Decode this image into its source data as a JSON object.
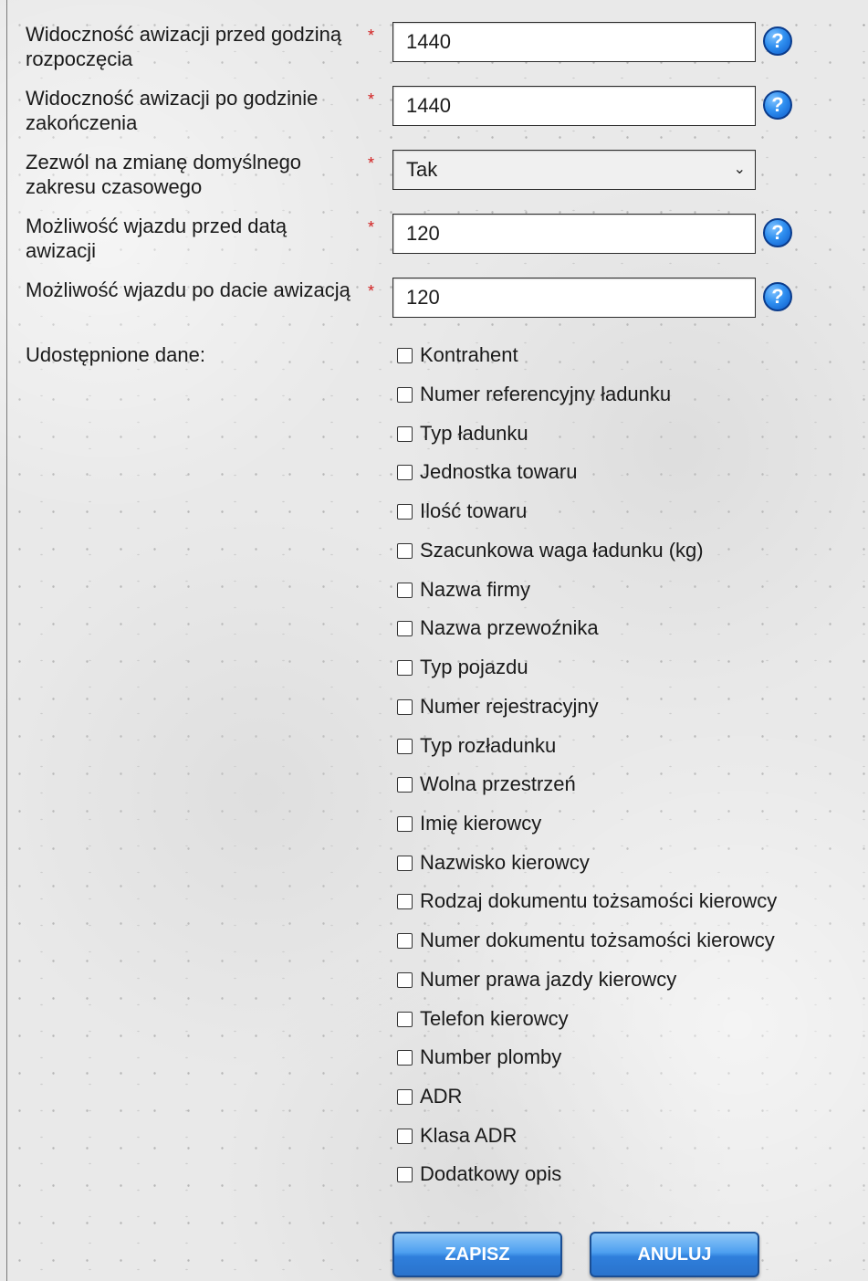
{
  "fields": [
    {
      "label": "Widoczność awizacji przed godziną rozpoczęcia",
      "required": "*",
      "value": "1440",
      "help": "?"
    },
    {
      "label": "Widoczność awizacji po godzinie zakończenia",
      "required": "*",
      "value": "1440",
      "help": "?"
    },
    {
      "label": "Zezwól na zmianę domyślnego zakresu czasowego",
      "required": "*",
      "value": "Tak"
    },
    {
      "label": "Możliwość wjazdu przed datą awizacji",
      "required": "*",
      "value": "120",
      "help": "?"
    },
    {
      "label": "Możliwość wjazdu po dacie awizacją",
      "required": "*",
      "value": "120",
      "help": "?"
    }
  ],
  "shared": {
    "label": "Udostępnione dane:",
    "items": [
      "Kontrahent",
      "Numer referencyjny ładunku",
      "Typ ładunku",
      "Jednostka towaru",
      "Ilość towaru",
      "Szacunkowa waga ładunku (kg)",
      "Nazwa firmy",
      "Nazwa przewoźnika",
      "Typ pojazdu",
      "Numer rejestracyjny",
      "Typ rozładunku",
      "Wolna przestrzeń",
      "Imię kierowcy",
      "Nazwisko kierowcy",
      "Rodzaj dokumentu tożsamości kierowcy",
      "Numer dokumentu tożsamości kierowcy",
      "Numer prawa jazdy kierowcy",
      "Telefon kierowcy",
      "Number plomby",
      "ADR",
      "Klasa ADR",
      "Dodatkowy opis"
    ]
  },
  "buttons": {
    "save": "ZAPISZ",
    "cancel": "ANULUJ"
  },
  "icons": {
    "help": "question-circle",
    "dropdown": "chevron-down"
  },
  "colors": {
    "required": "#d21f1f",
    "button": "#2f7fdc",
    "help": "#2f8ff0"
  }
}
